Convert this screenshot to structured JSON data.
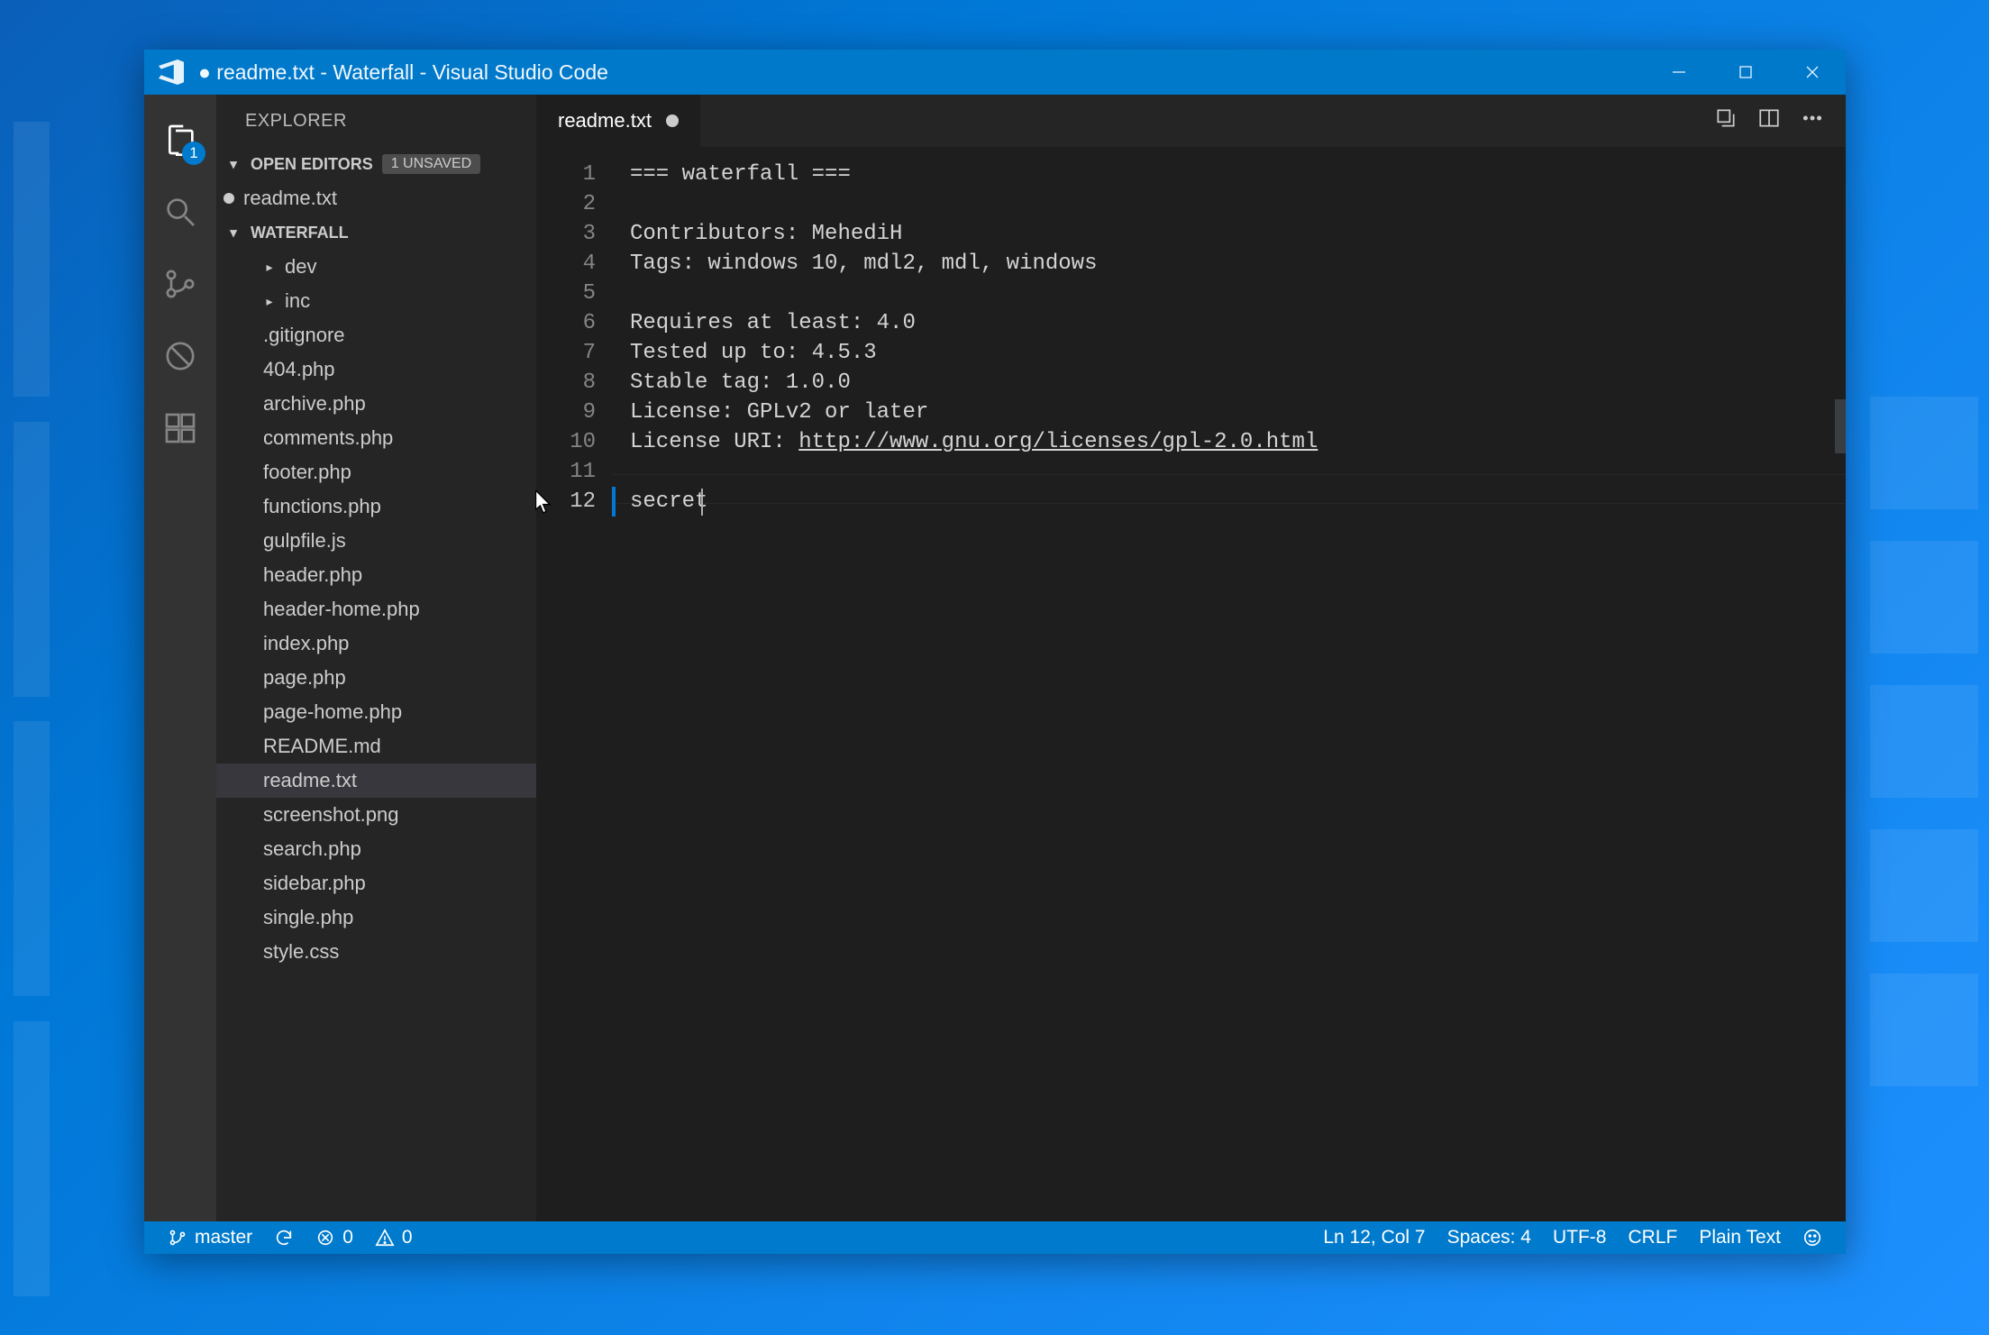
{
  "title": "● readme.txt - Waterfall - Visual Studio Code",
  "activitybar": {
    "badge": "1"
  },
  "sidebar": {
    "panel_title": "EXPLORER",
    "open_editors": {
      "label": "OPEN EDITORS",
      "unsaved": "1 UNSAVED",
      "items": [
        {
          "label": "readme.txt",
          "modified": true
        }
      ]
    },
    "workspace": {
      "label": "WATERFALL",
      "tree": [
        {
          "label": "dev",
          "kind": "folder"
        },
        {
          "label": "inc",
          "kind": "folder"
        },
        {
          "label": ".gitignore",
          "kind": "file"
        },
        {
          "label": "404.php",
          "kind": "file"
        },
        {
          "label": "archive.php",
          "kind": "file"
        },
        {
          "label": "comments.php",
          "kind": "file"
        },
        {
          "label": "footer.php",
          "kind": "file"
        },
        {
          "label": "functions.php",
          "kind": "file"
        },
        {
          "label": "gulpfile.js",
          "kind": "file"
        },
        {
          "label": "header.php",
          "kind": "file"
        },
        {
          "label": "header-home.php",
          "kind": "file"
        },
        {
          "label": "index.php",
          "kind": "file"
        },
        {
          "label": "page.php",
          "kind": "file"
        },
        {
          "label": "page-home.php",
          "kind": "file"
        },
        {
          "label": "README.md",
          "kind": "file"
        },
        {
          "label": "readme.txt",
          "kind": "file",
          "selected": true
        },
        {
          "label": "screenshot.png",
          "kind": "file"
        },
        {
          "label": "search.php",
          "kind": "file"
        },
        {
          "label": "sidebar.php",
          "kind": "file"
        },
        {
          "label": "single.php",
          "kind": "file"
        },
        {
          "label": "style.css",
          "kind": "file"
        }
      ]
    }
  },
  "tabs": {
    "active": {
      "label": "readme.txt",
      "modified": true
    }
  },
  "editor": {
    "lines": [
      "=== waterfall ===",
      "",
      "Contributors: MehediH",
      "Tags: windows 10, mdl2, mdl, windows",
      "",
      "Requires at least: 4.0",
      "Tested up to: 4.5.3",
      "Stable tag: 1.0.0",
      "License: GPLv2 or later",
      "License URI: ",
      "",
      "secret"
    ],
    "license_uri": "http://www.gnu.org/licenses/gpl-2.0.html",
    "current_line_index": 11
  },
  "statusbar": {
    "branch": "master",
    "errors": "0",
    "warnings": "0",
    "ln_col": "Ln 12, Col 7",
    "spaces": "Spaces: 4",
    "encoding": "UTF-8",
    "eol": "CRLF",
    "language": "Plain Text"
  }
}
